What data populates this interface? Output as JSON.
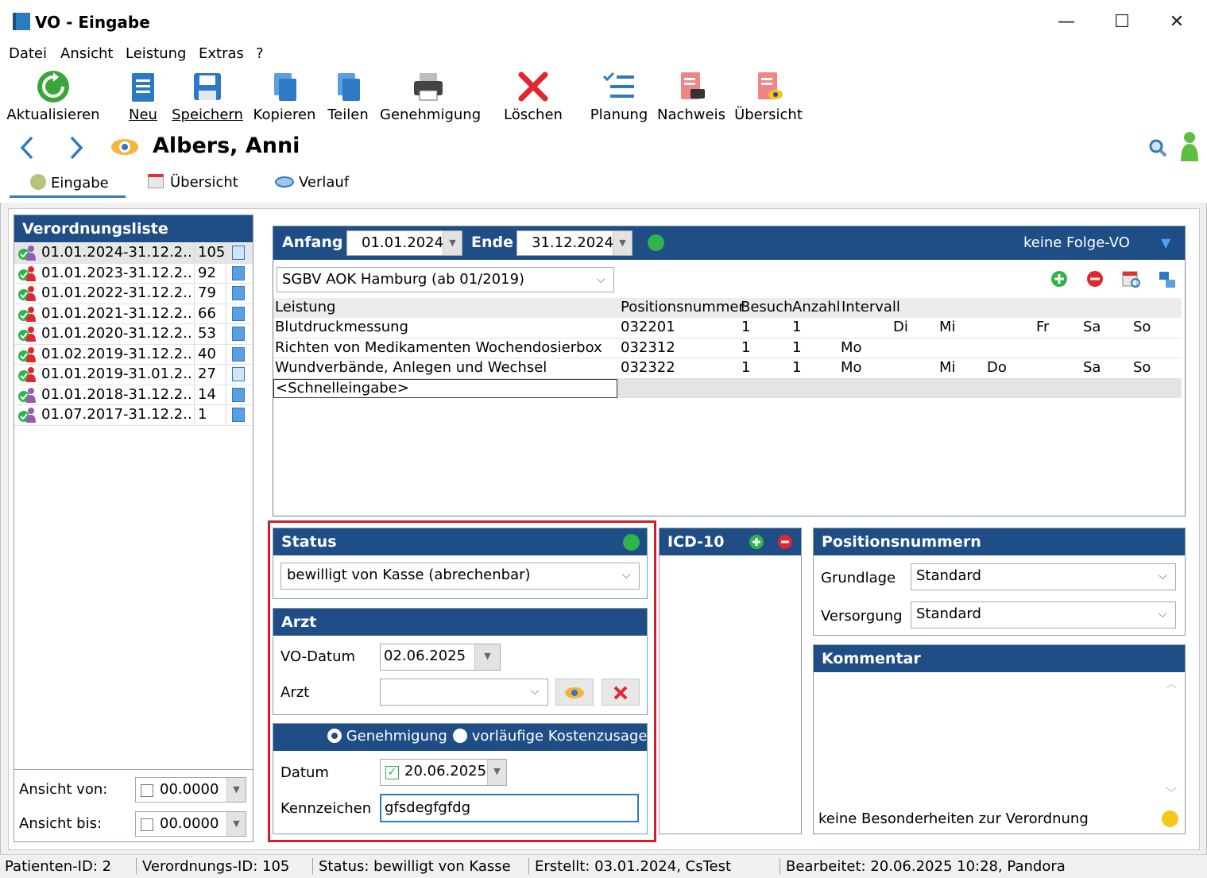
{
  "window": {
    "title": "VO - Eingabe",
    "minimize": "—",
    "maximize": "☐",
    "close": "✕"
  },
  "menu": [
    "Datei",
    "Ansicht",
    "Leistung",
    "Extras",
    "?"
  ],
  "toolbar": {
    "refresh": "Aktualisieren",
    "new": "Neu",
    "save": "Speichern",
    "copy": "Kopieren",
    "share": "Teilen",
    "approval": "Genehmigung",
    "delete": "Löschen",
    "planning": "Planung",
    "proof": "Nachweis",
    "overview": "Übersicht"
  },
  "patient_name": "Albers, Anni",
  "tabs": [
    "Eingabe",
    "Übersicht",
    "Verlauf"
  ],
  "vo_list": {
    "title": "Verordnungsliste",
    "rows": [
      {
        "range": "01.01.2024-31.12.2..",
        "num": "105"
      },
      {
        "range": "01.01.2023-31.12.2..",
        "num": "92"
      },
      {
        "range": "01.01.2022-31.12.2..",
        "num": "79"
      },
      {
        "range": "01.01.2021-31.12.2..",
        "num": "66"
      },
      {
        "range": "01.01.2020-31.12.2..",
        "num": "53"
      },
      {
        "range": "01.02.2019-31.12.2..",
        "num": "40"
      },
      {
        "range": "01.01.2019-31.01.2..",
        "num": "27"
      },
      {
        "range": "01.01.2018-31.12.2..",
        "num": "14"
      },
      {
        "range": "01.07.2017-31.12.2..",
        "num": "1"
      }
    ],
    "ansicht_von_label": "Ansicht von:",
    "ansicht_von_value": "00.0000",
    "ansicht_bis_label": "Ansicht bis:",
    "ansicht_bis_value": "00.0000"
  },
  "period": {
    "start_label": "Anfang",
    "start_value": "01.01.2024",
    "end_label": "Ende",
    "end_value": "31.12.2024",
    "follow_label": "keine Folge-VO"
  },
  "insurance": "SGBV AOK Hamburg (ab 01/2019)",
  "services": {
    "headers": [
      "Leistung",
      "Positionsnummer",
      "Besuch",
      "Anzahl",
      "Intervall"
    ],
    "rows": [
      {
        "name": "Blutdruckmessung",
        "pos": "032201",
        "visit": "1",
        "count": "1",
        "days": [
          "",
          "Di",
          "Mi",
          "",
          "Fr",
          "Sa",
          "So"
        ]
      },
      {
        "name": "Richten von Medikamenten Wochendosierbox",
        "pos": "032312",
        "visit": "1",
        "count": "1",
        "days": [
          "Mo",
          "",
          "",
          "",
          "",
          "",
          ""
        ]
      },
      {
        "name": "Wundverbände, Anlegen und Wechsel",
        "pos": "032322",
        "visit": "1",
        "count": "1",
        "days": [
          "Mo",
          "",
          "Mi",
          "Do",
          "",
          "Sa",
          "So"
        ]
      }
    ],
    "quick_entry": "<Schnelleingabe>"
  },
  "status": {
    "title": "Status",
    "value": "bewilligt von Kasse (abrechenbar)"
  },
  "arzt": {
    "title": "Arzt",
    "vo_datum_label": "VO-Datum",
    "vo_datum_value": "02.06.2025",
    "arzt_label": "Arzt",
    "arzt_value": ""
  },
  "approval": {
    "option1": "Genehmigung",
    "option2": "vorläufige Kostenzusage",
    "datum_label": "Datum",
    "datum_value": "20.06.2025",
    "kennzeichen_label": "Kennzeichen",
    "kennzeichen_value": "gfsdegfgfdg"
  },
  "icd": {
    "title": "ICD-10"
  },
  "positions": {
    "title": "Positionsnummern",
    "grundlage_label": "Grundlage",
    "grundlage_value": "Standard",
    "versorgung_label": "Versorgung",
    "versorgung_value": "Standard"
  },
  "comment": {
    "title": "Kommentar",
    "text": "keine Besonderheiten zur Verordnung"
  },
  "statusbar": {
    "patient_id": "Patienten-ID: 2",
    "vo_id": "Verordnungs-ID: 105",
    "status": "Status: bewilligt von Kasse",
    "created": "Erstellt: 03.01.2024, CsTest",
    "edited": "Bearbeitet: 20.06.2025 10:28, Pandora"
  },
  "colors": {
    "header_blue": "#1f4e86",
    "status_green": "#2fb34a",
    "highlight_red": "#d0202a"
  }
}
